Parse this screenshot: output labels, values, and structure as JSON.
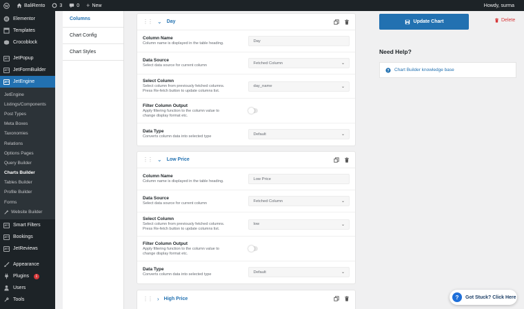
{
  "adminbar": {
    "site_name": "BaliRento",
    "updates_count": "3",
    "comments_count": "0",
    "new_label": "New",
    "howdy": "Howdy, surma"
  },
  "sidebar": {
    "top_items": [
      {
        "label": "Elementor",
        "icon": "elementor-icon"
      },
      {
        "label": "Templates",
        "icon": "templates-icon"
      },
      {
        "label": "Crocoblock",
        "icon": "crocoblock-icon"
      }
    ],
    "jet_items": [
      {
        "label": "JetPopup"
      },
      {
        "label": "JetFormBuilder"
      },
      {
        "label": "JetEngine"
      }
    ],
    "submenu": [
      {
        "label": "JetEngine"
      },
      {
        "label": "Listings/Components"
      },
      {
        "label": "Post Types"
      },
      {
        "label": "Meta Boxes"
      },
      {
        "label": "Taxonomies"
      },
      {
        "label": "Relations"
      },
      {
        "label": "Options Pages"
      },
      {
        "label": "Query Builder"
      },
      {
        "label": "Charts Builder"
      },
      {
        "label": "Tables Builder"
      },
      {
        "label": "Profile Builder"
      },
      {
        "label": "Forms"
      },
      {
        "label": "Website Builder"
      }
    ],
    "bottom_jet_items": [
      {
        "label": "Smart Filters"
      },
      {
        "label": "Bookings"
      },
      {
        "label": "JetReviews"
      }
    ],
    "wp_items": [
      {
        "label": "Appearance"
      },
      {
        "label": "Plugins",
        "badge": "1"
      },
      {
        "label": "Users"
      },
      {
        "label": "Tools"
      }
    ]
  },
  "tabs": [
    "Columns",
    "Chart Config",
    "Chart Styles"
  ],
  "field_labels": {
    "column_name": {
      "title": "Column Name",
      "desc": "Column name is displayed in the table heading."
    },
    "data_source": {
      "title": "Data Source",
      "desc": "Select data source for current column"
    },
    "select_column": {
      "title": "Select Column",
      "desc1": "Select column from previously fetched columns.",
      "desc2": "Press Re-fetch button to update columns list."
    },
    "filter_column": {
      "title": "Filter Column Output",
      "desc1": "Apply filtering function to the column value to",
      "desc2": "change display format etc."
    },
    "data_type": {
      "title": "Data Type",
      "desc": "Converts column data into selected type"
    }
  },
  "columns": [
    {
      "title": "Day",
      "column_name": "Day",
      "data_source": "Fetched Column",
      "select_column": "day_name",
      "data_type": "Default"
    },
    {
      "title": "Low Price",
      "column_name": "Low Price",
      "data_source": "Fetched Column",
      "select_column": "low",
      "data_type": "Default"
    },
    {
      "title": "High Price"
    }
  ],
  "actions": {
    "update": "Update Chart",
    "delete": "Delete"
  },
  "help": {
    "title": "Need Help?",
    "link": "Chart Builder knowledge base"
  },
  "stuck": "Got Stuck? Click Here",
  "colors": {
    "accent": "#2271b1",
    "danger": "#d63638",
    "sidebar": "#1d2327"
  }
}
